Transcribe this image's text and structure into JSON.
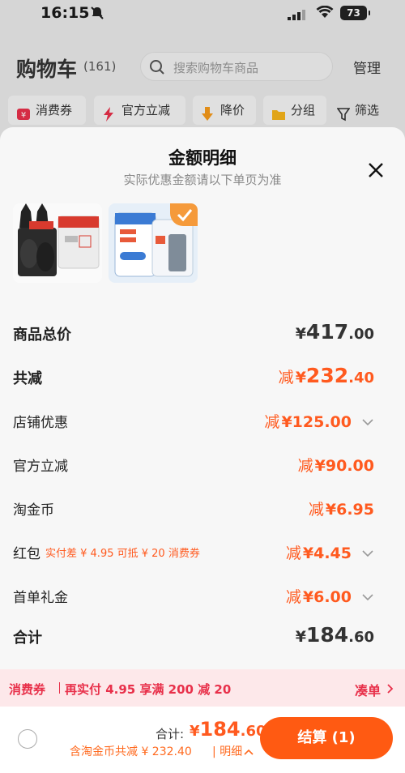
{
  "status_bar": {
    "time": "16:15",
    "battery": "73"
  },
  "header": {
    "title": "购物车",
    "count": "(161)",
    "search_placeholder": "搜索购物车商品",
    "manage": "管理"
  },
  "filters": [
    {
      "label": "消费券",
      "icon": "coupon-icon"
    },
    {
      "label": "官方立减",
      "icon": "lightning-icon"
    },
    {
      "label": "降价",
      "icon": "price-drop-icon"
    },
    {
      "label": "分组",
      "icon": "folder-icon"
    },
    {
      "label": "筛选",
      "icon": "filter-icon"
    }
  ],
  "sheet": {
    "title": "金额明细",
    "subtitle": "实际优惠金额请以下单页为准",
    "rows": [
      {
        "label": "商品总价",
        "prefix": "",
        "currency": "¥",
        "int": "417",
        "dec": ".00"
      },
      {
        "label": "共减",
        "prefix": "减",
        "currency": "¥",
        "int": "232",
        "dec": ".40"
      },
      {
        "label": "店铺优惠",
        "prefix": "减",
        "currency": "¥",
        "amount": "125.00"
      },
      {
        "label": "官方立减",
        "prefix": "减",
        "currency": "¥",
        "amount": "90.00"
      },
      {
        "label": "淘金币",
        "prefix": "减",
        "currency": "¥",
        "amount": "6.95"
      },
      {
        "label": "红包",
        "note": "实付差 ¥ 4.95 可抵 ¥ 20 消费券",
        "prefix": "减",
        "currency": "¥",
        "amount": "4.45"
      },
      {
        "label": "首单礼金",
        "prefix": "减",
        "currency": "¥",
        "amount": "6.00"
      },
      {
        "label": "合计",
        "prefix": "",
        "currency": "¥",
        "int": "184",
        "dec": ".60"
      }
    ]
  },
  "banner": {
    "tag": "消费券",
    "text": "再实付 4.95 享满 200 减 20",
    "action": "凑单"
  },
  "bottom": {
    "total_label": "合计:",
    "total_currency": "¥",
    "total_int": "184",
    "total_dec": ".60",
    "sub_note": "含淘金币共减 ¥ 232.40",
    "detail_toggle": "明细",
    "checkout": "结算 (1)"
  },
  "colors": {
    "accent": "#ff5a12",
    "discount": "#ff5a1f",
    "coupon": "#e8304a"
  }
}
